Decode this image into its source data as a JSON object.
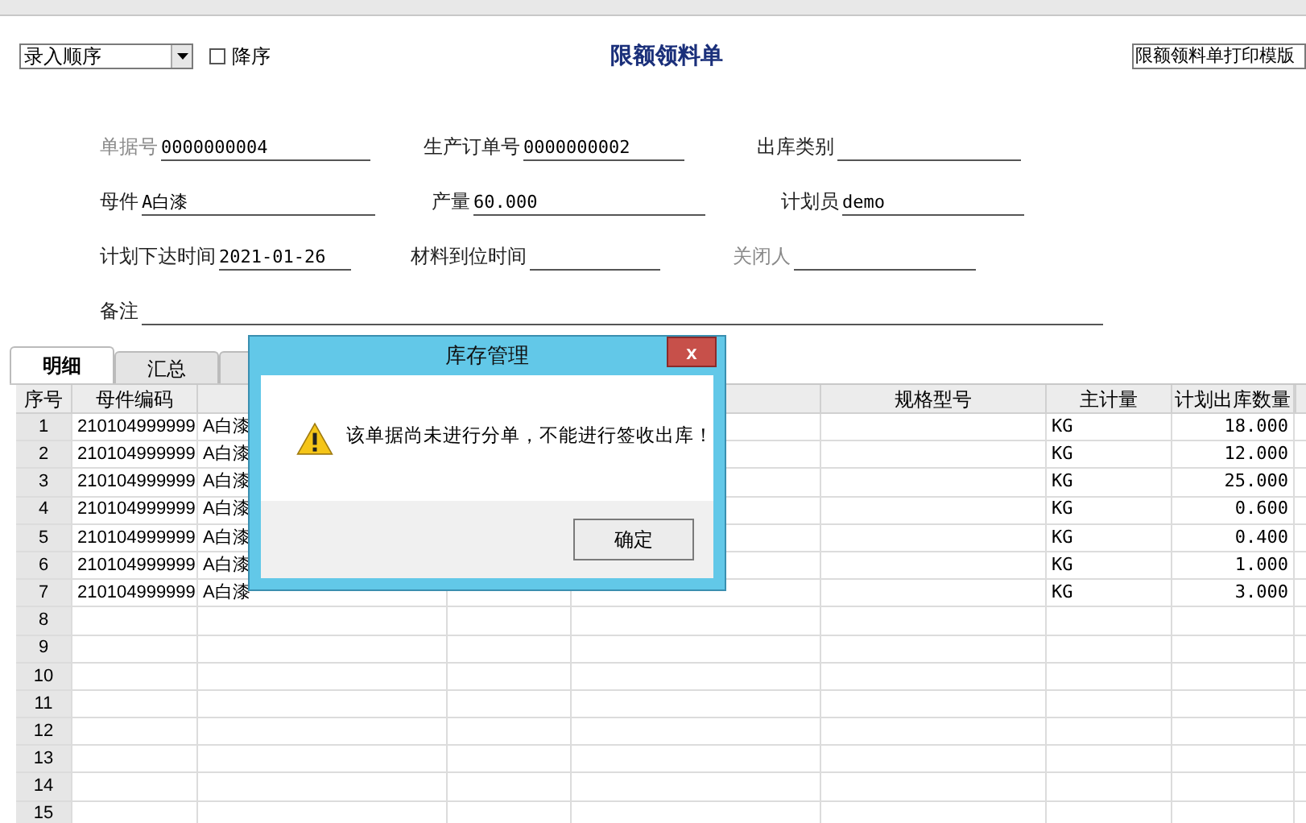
{
  "sort_select": {
    "value": "录入顺序"
  },
  "descending": {
    "label": "降序",
    "checked": false
  },
  "title": "限额领料单",
  "template_select": {
    "value": "限额领料单打印模版"
  },
  "form_rows": [
    [
      {
        "label": "单据号",
        "value": "0000000004",
        "disabled": true
      },
      {
        "label": "生产订单号",
        "value": "0000000002",
        "disabled": false
      },
      {
        "label": "出库类别",
        "disabled": false
      }
    ],
    [
      {
        "label": "母件",
        "value": "A白漆",
        "disabled": false
      },
      {
        "label": "产量",
        "value": "60.000",
        "disabled": false
      },
      {
        "label": "计划员",
        "value": "demo",
        "disabled": false
      }
    ],
    [
      {
        "label": "计划下达时间",
        "value": "2021-01-26",
        "disabled": false
      },
      {
        "label": "材料到位时间",
        "disabled": false
      },
      {
        "label": "关闭人",
        "disabled": true
      }
    ],
    [
      {
        "label": "备注",
        "disabled": false
      }
    ]
  ],
  "tabs": [
    {
      "label": "明细",
      "selected": true
    },
    {
      "label": "汇总",
      "selected": false
    }
  ],
  "table": {
    "columns": [
      "序号",
      "母件编码",
      "",
      "",
      "",
      "规格型号",
      "主计量",
      "计划出库数量"
    ],
    "rows": [
      [
        "1",
        "210104999999",
        "A白漆",
        null,
        null,
        "",
        "KG",
        "18.000"
      ],
      [
        "2",
        "210104999999",
        "A白漆",
        null,
        null,
        "",
        "KG",
        "12.000"
      ],
      [
        "3",
        "210104999999",
        "A白漆",
        null,
        null,
        "",
        "KG",
        "25.000"
      ],
      [
        "4",
        "210104999999",
        "A白漆",
        null,
        null,
        "",
        "KG",
        "0.600"
      ],
      [
        "5",
        "210104999999",
        "A白漆",
        null,
        null,
        "",
        "KG",
        "0.400"
      ],
      [
        "6",
        "210104999999",
        "A白漆",
        null,
        null,
        "",
        "KG",
        "1.000"
      ],
      [
        "7",
        "210104999999",
        "A白漆",
        null,
        null,
        "",
        "KG",
        "3.000"
      ],
      [
        "8",
        "",
        "",
        "",
        "",
        "",
        "",
        ""
      ],
      [
        "9",
        "",
        "",
        "",
        "",
        "",
        "",
        ""
      ],
      [
        "10",
        "",
        "",
        "",
        "",
        "",
        "",
        ""
      ],
      [
        "11",
        "",
        "",
        "",
        "",
        "",
        "",
        ""
      ],
      [
        "12",
        "",
        "",
        "",
        "",
        "",
        "",
        ""
      ],
      [
        "13",
        "",
        "",
        "",
        "",
        "",
        "",
        ""
      ],
      [
        "14",
        "",
        "",
        "",
        "",
        "",
        "",
        ""
      ],
      [
        "15",
        "",
        "",
        "",
        "",
        "",
        "",
        ""
      ]
    ]
  },
  "dialog": {
    "title": "库存管理",
    "close": "x",
    "message": "该单据尚未进行分单，不能进行签收出库！",
    "button": "确定"
  }
}
